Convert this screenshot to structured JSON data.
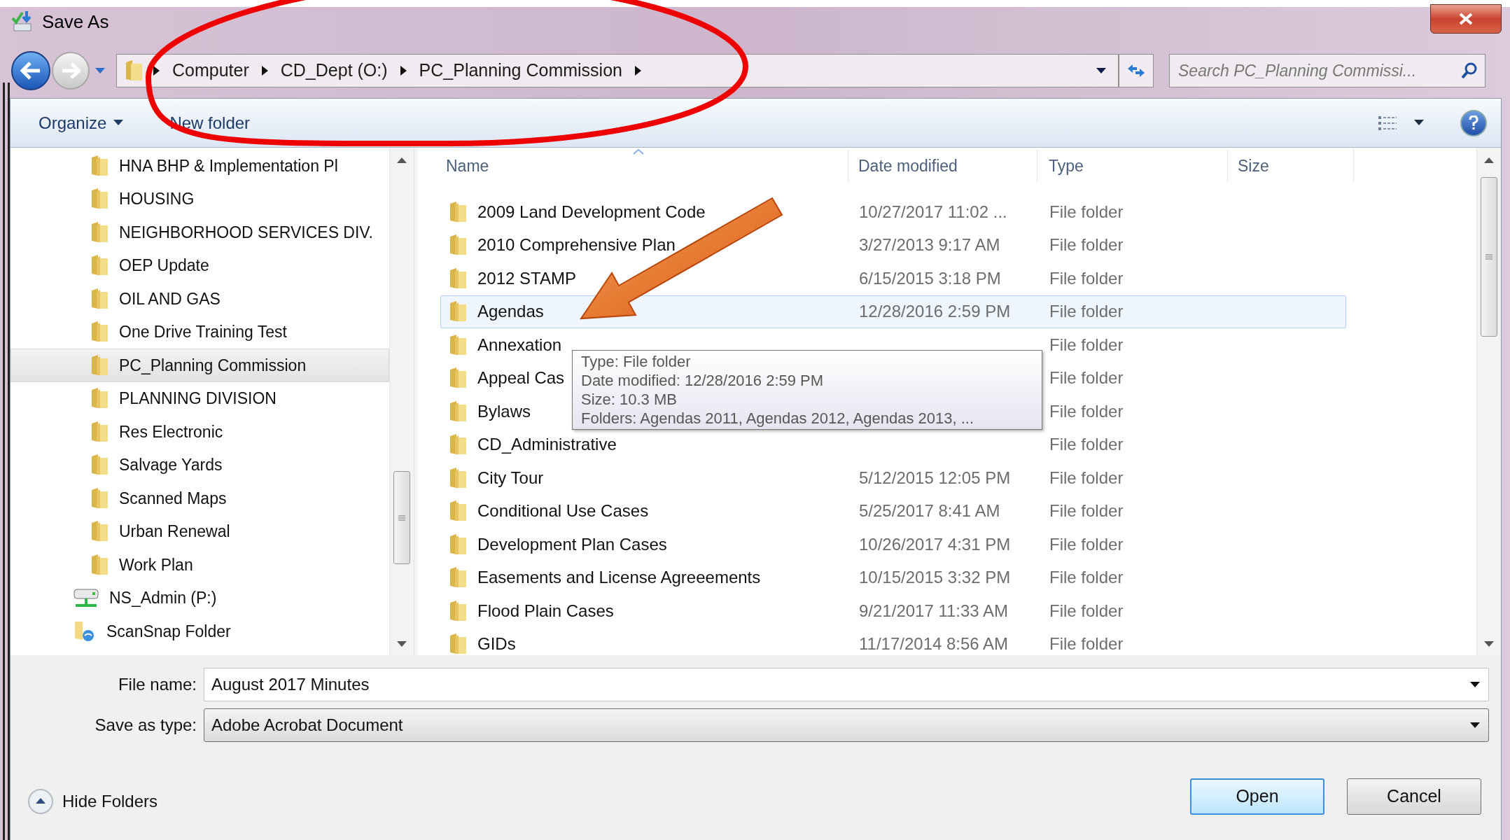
{
  "window": {
    "title": "Save As"
  },
  "address_bar": {
    "breadcrumbs": [
      "Computer",
      "CD_Dept (O:)",
      "PC_Planning Commission"
    ]
  },
  "search": {
    "placeholder": "Search PC_Planning Commissi..."
  },
  "toolbar": [
    {
      "label": "Organize",
      "menu": true
    },
    {
      "label": "New folder",
      "menu": false
    }
  ],
  "tree": [
    {
      "children": [
        {
          "label": "HNA BHP & Implementation Pl",
          "kind": "folder",
          "selected": false
        },
        {
          "label": "HOUSING",
          "kind": "folder",
          "selected": false
        },
        {
          "label": "NEIGHBORHOOD SERVICES DIV.",
          "kind": "folder",
          "selected": false
        },
        {
          "label": "OEP Update",
          "kind": "folder",
          "selected": false
        },
        {
          "label": "OIL AND GAS",
          "kind": "folder",
          "selected": false
        },
        {
          "label": "One Drive Training Test",
          "kind": "folder",
          "selected": false
        },
        {
          "label": "PC_Planning Commission",
          "kind": "folder",
          "selected": true
        },
        {
          "label": "PLANNING DIVISION",
          "kind": "folder",
          "selected": false
        },
        {
          "label": "Res Electronic",
          "kind": "folder",
          "selected": false
        },
        {
          "label": "Salvage Yards",
          "kind": "folder",
          "selected": false
        },
        {
          "label": "Scanned Maps",
          "kind": "folder",
          "selected": false
        },
        {
          "label": "Urban Renewal",
          "kind": "folder",
          "selected": false
        },
        {
          "label": "Work Plan",
          "kind": "folder",
          "selected": false
        }
      ]
    },
    {
      "label": "NS_Admin (P:)",
      "kind": "drive",
      "selected": false
    },
    {
      "label": "ScanSnap Folder",
      "kind": "scansnap",
      "selected": false
    }
  ],
  "columns": [
    {
      "label": "Name",
      "sorted": true
    },
    {
      "label": "Date modified",
      "sorted": false
    },
    {
      "label": "Type",
      "sorted": false
    },
    {
      "label": "Size",
      "sorted": false
    }
  ],
  "rows": [
    {
      "name": "2009 Land Development Code",
      "date": "10/27/2017 11:02 ...",
      "type": "File folder",
      "selected": false
    },
    {
      "name": "2010 Comprehensive Plan",
      "date": "3/27/2013 9:17 AM",
      "type": "File folder",
      "selected": false
    },
    {
      "name": "2012 STAMP",
      "date": "6/15/2015 3:18 PM",
      "type": "File folder",
      "selected": false
    },
    {
      "name": "Agendas",
      "date": "12/28/2016 2:59 PM",
      "type": "File folder",
      "selected": true
    },
    {
      "name": "Annexation",
      "type": "File folder",
      "selected": false
    },
    {
      "name": "Appeal Cas",
      "type": "File folder",
      "selected": false
    },
    {
      "name": "Bylaws",
      "type": "File folder",
      "selected": false
    },
    {
      "name": "CD_Administrative",
      "type": "File folder",
      "selected": false
    },
    {
      "name": "City Tour",
      "date": "5/12/2015 12:05 PM",
      "type": "File folder",
      "selected": false
    },
    {
      "name": "Conditional Use Cases",
      "date": "5/25/2017 8:41 AM",
      "type": "File folder",
      "selected": false
    },
    {
      "name": "Development Plan Cases",
      "date": "10/26/2017 4:31 PM",
      "type": "File folder",
      "selected": false
    },
    {
      "name": "Easements and License Agreeements",
      "date": "10/15/2015 3:32 PM",
      "type": "File folder",
      "selected": false
    },
    {
      "name": "Flood Plain Cases",
      "date": "9/21/2017 11:33 AM",
      "type": "File folder",
      "selected": false
    },
    {
      "name": "GIDs",
      "date": "11/17/2014 8:56 AM",
      "type": "File folder",
      "selected": false
    }
  ],
  "tooltip": {
    "lines": [
      "Type: File folder",
      "Date modified: 12/28/2016 2:59 PM",
      "Size: 10.3 MB",
      "Folders: Agendas 2011, Agendas 2012, Agendas 2013, ..."
    ]
  },
  "file_name": {
    "label": "File name:",
    "value": "August 2017 Minutes"
  },
  "save_as_type": {
    "label": "Save as type:",
    "value": "Adobe Acrobat Document"
  },
  "hide_folders": "Hide Folders",
  "buttons": [
    {
      "label": "Open",
      "default": true
    },
    {
      "label": "Cancel",
      "default": false
    }
  ]
}
